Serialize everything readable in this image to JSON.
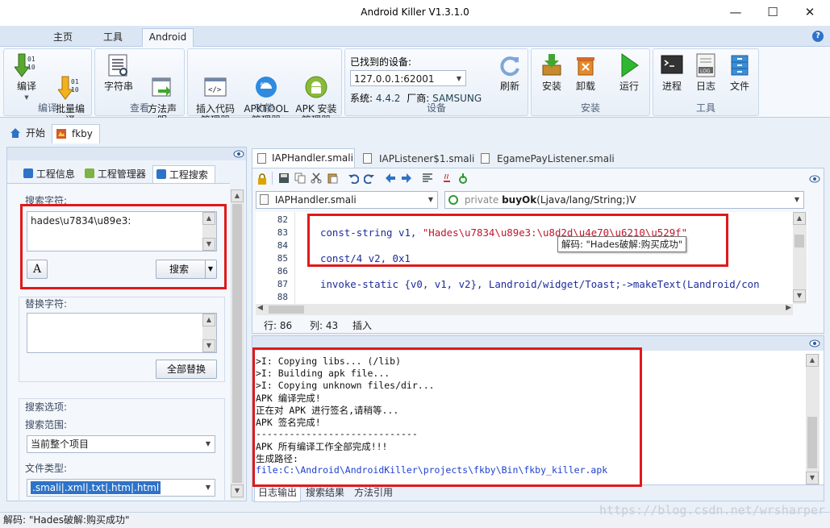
{
  "window": {
    "title": "Android Killer V1.3.1.0",
    "minimize_glyph": "—",
    "maximize_glyph": "☐",
    "close_glyph": "✕"
  },
  "ribbon_tabs": [
    {
      "label": "主页",
      "active": false
    },
    {
      "label": "工具",
      "active": false
    },
    {
      "label": "Android",
      "active": true
    }
  ],
  "help_glyph": "?",
  "ribbon": {
    "groups": {
      "compile": "编译",
      "view": "查看",
      "function": "功能",
      "device": "设备",
      "install": "安装",
      "tools": "工具"
    },
    "buttons": {
      "compile": "编译",
      "batch_compile": "批量编\n译",
      "string": "字符串",
      "method_decl": "方法声\n明",
      "insert_code": "插入代码\n管理器",
      "apktool": "APKTOOL\n管理器",
      "apk_install": "APK 安装\n管理器",
      "refresh": "刷新",
      "install": "安装",
      "uninstall": "卸载",
      "run": "运行",
      "process": "进程",
      "log": "日志",
      "file": "文件"
    },
    "device": {
      "found_label": "已找到的设备:",
      "selected": "127.0.0.1:62001",
      "system_label": "系统:",
      "system_value": "4.4.2",
      "vendor_label": "厂商:",
      "vendor_value": "SAMSUNG"
    },
    "icon_text": {
      "binary_top": "01",
      "binary_bottom": "10",
      "apk_badge": "APK",
      "log_badge": "LOG"
    }
  },
  "doc_tabs": [
    {
      "label": "开始"
    },
    {
      "label": "fkby"
    }
  ],
  "left_panel": {
    "tabs": [
      {
        "label": "工程信息"
      },
      {
        "label": "工程管理器"
      },
      {
        "label": "工程搜索"
      }
    ],
    "search_label": "搜索字符:",
    "search_value": "hades\\u7834\\u89e3:",
    "font_icon_glyph": "A",
    "search_button": "搜索",
    "replace_label": "替换字符:",
    "replace_value": "",
    "replace_all_button": "全部替换",
    "options_label": "搜索选项:",
    "scope_label": "搜索范围:",
    "scope_value": "当前整个项目",
    "filetype_label": "文件类型:",
    "filetype_value": ".smali|.xml|.txt|.htm|.html"
  },
  "editor": {
    "file_tabs": [
      {
        "label": "IAPHandler.smali",
        "active": true
      },
      {
        "label": "IAPListener$1.smali",
        "active": false
      },
      {
        "label": "EgamePayListener.smali",
        "active": false
      }
    ],
    "class_combo": "IAPHandler.smali",
    "method_combo": {
      "prefix": "private",
      "name": "buyOk",
      "signature": "(Ljava/lang/String;)V"
    },
    "lines": [
      {
        "num": "82",
        "html": ""
      },
      {
        "num": "83",
        "kw": "const-string",
        "regs": " v1, ",
        "str": "\"Hades\\u7834\\u89e3:\\u8d2d\\u4e70\\u6210\\u529f\""
      },
      {
        "num": "84",
        "kw": "",
        "regs": "",
        "str": ""
      },
      {
        "num": "85",
        "kw": "const/4",
        "regs": " v2, 0x1",
        "str": ""
      },
      {
        "num": "86",
        "kw": "",
        "regs": "",
        "str": ""
      },
      {
        "num": "87",
        "kw": "invoke-static",
        "regs": " {v0, v1, v2}, Landroid/widget/Toast;->makeText(Landroid/con",
        "str": ""
      },
      {
        "num": "88",
        "kw": "",
        "regs": "",
        "str": ""
      }
    ],
    "tooltip": "解码: \"Hades破解:购买成功\"",
    "status": {
      "row_label": "行:",
      "row_value": "86",
      "col_label": "列:",
      "col_value": "43",
      "mode": "插入"
    }
  },
  "log": {
    "lines": [
      ">I: Copying libs... (/lib)",
      ">I: Building apk file...",
      ">I: Copying unknown files/dir...",
      "APK 编译完成!",
      "正在对 APK 进行签名,请稍等...",
      "APK 签名完成!",
      "-----------------------------",
      "APK 所有编译工作全部完成!!!",
      "生成路径:",
      "file:C:\\Android\\AndroidKiller\\projects\\fkby\\Bin\\fkby_killer.apk"
    ],
    "path_color": "#1f3fcf",
    "tabs": [
      {
        "label": "日志输出",
        "active": true
      },
      {
        "label": "搜索结果",
        "active": false
      },
      {
        "label": "方法引用",
        "active": false
      }
    ]
  },
  "statusbar": "解码: \"Hades破解:购买成功\"",
  "watermark": "https://blog.csdn.net/wrsharper",
  "colors": {
    "accent": "#2d73c8",
    "highlight_box": "#e0191b",
    "keyword": "#1d2c9a",
    "string": "#c2152c"
  }
}
